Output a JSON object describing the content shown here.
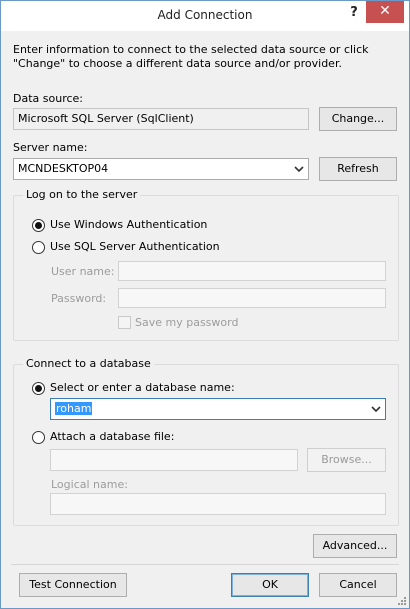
{
  "window": {
    "title": "Add Connection",
    "help_label": "?",
    "close_label": "✕"
  },
  "intro": "Enter information to connect to the selected data source or click \"Change\" to choose a different data source and/or provider.",
  "data_source": {
    "label": "Data source:",
    "value": "Microsoft SQL Server (SqlClient)",
    "change_button": "Change..."
  },
  "server": {
    "label": "Server name:",
    "value": "MCNDESKTOP04",
    "refresh_button": "Refresh"
  },
  "logon": {
    "group_label": "Log on to the server",
    "windows_auth": "Use Windows Authentication",
    "sql_auth": "Use SQL Server Authentication",
    "user_name_label": "User name:",
    "password_label": "Password:",
    "save_password": "Save my password"
  },
  "database": {
    "group_label": "Connect to a database",
    "select_option": "Select or enter a database name:",
    "db_name": "roham",
    "attach_option": "Attach a database file:",
    "browse_button": "Browse...",
    "logical_name_label": "Logical name:"
  },
  "footer": {
    "advanced_button": "Advanced...",
    "test_button": "Test Connection",
    "ok_button": "OK",
    "cancel_button": "Cancel"
  }
}
